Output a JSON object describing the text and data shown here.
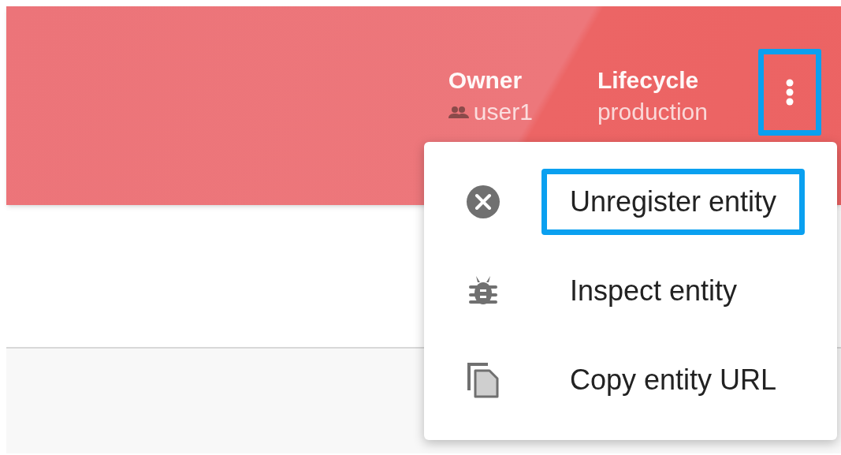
{
  "header": {
    "fields": [
      {
        "label": "Owner",
        "value": "user1",
        "kind": "group"
      },
      {
        "label": "Lifecycle",
        "value": "production",
        "kind": "plain"
      }
    ],
    "menu_button": {
      "highlighted": true
    }
  },
  "menu": {
    "items": [
      {
        "label": "Unregister entity",
        "kind": "cancel",
        "highlighted": true
      },
      {
        "label": "Inspect entity",
        "kind": "bug",
        "highlighted": false
      },
      {
        "label": "Copy entity URL",
        "kind": "copy",
        "highlighted": false
      }
    ]
  }
}
